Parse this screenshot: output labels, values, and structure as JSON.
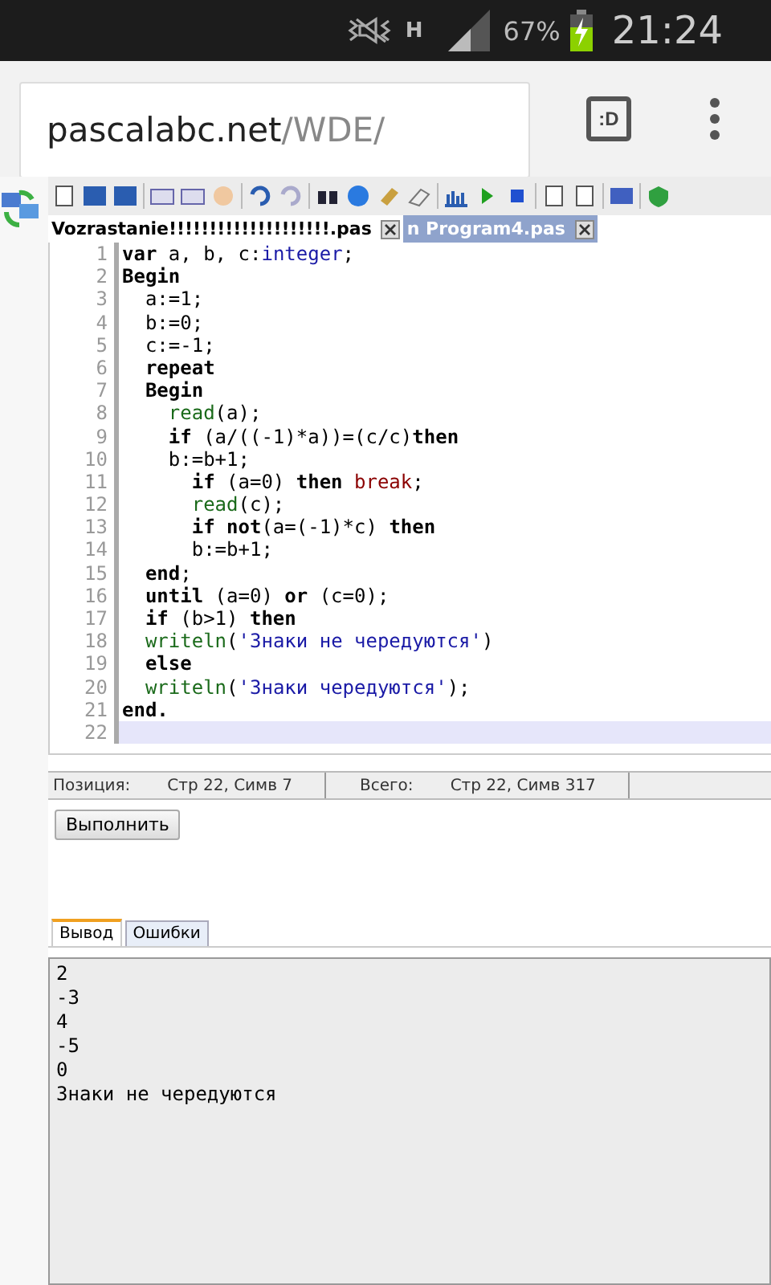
{
  "status_bar": {
    "network": "H",
    "battery": "67%",
    "time": "21:24"
  },
  "browser": {
    "url_host": "pascalabc.net",
    "url_path": "/WDE/",
    "tab_button": ":D"
  },
  "editor_tabs": [
    {
      "label": "Vozrastanie!!!!!!!!!!!!!!!!!!!!.pas",
      "selected": false
    },
    {
      "label": "n Program4.pas",
      "selected": true
    }
  ],
  "code": {
    "lines": [
      {
        "number": "1",
        "current": false,
        "tokens": [
          {
            "kind": "kw",
            "text": "var"
          },
          {
            "kind": "plain",
            "text": " a, b, c:"
          },
          {
            "kind": "type",
            "text": "integer"
          },
          {
            "kind": "plain",
            "text": ";"
          }
        ]
      },
      {
        "number": "2",
        "current": false,
        "tokens": [
          {
            "kind": "kw",
            "text": "Begin"
          }
        ]
      },
      {
        "number": "3",
        "current": false,
        "tokens": [
          {
            "kind": "plain",
            "text": "  a:=1;"
          }
        ]
      },
      {
        "number": "4",
        "current": false,
        "tokens": [
          {
            "kind": "plain",
            "text": "  b:=0;"
          }
        ]
      },
      {
        "number": "5",
        "current": false,
        "tokens": [
          {
            "kind": "plain",
            "text": "  c:=-1;"
          }
        ]
      },
      {
        "number": "6",
        "current": false,
        "tokens": [
          {
            "kind": "kw",
            "text": "  repeat"
          }
        ]
      },
      {
        "number": "7",
        "current": false,
        "tokens": [
          {
            "kind": "kw",
            "text": "  Begin"
          }
        ]
      },
      {
        "number": "8",
        "current": false,
        "tokens": [
          {
            "kind": "func",
            "text": "    read"
          },
          {
            "kind": "plain",
            "text": "(a);"
          }
        ]
      },
      {
        "number": "9",
        "current": false,
        "tokens": [
          {
            "kind": "kw",
            "text": "    if"
          },
          {
            "kind": "plain",
            "text": " (a/((-1)*a))=(c/c)"
          },
          {
            "kind": "kw",
            "text": "then"
          }
        ]
      },
      {
        "number": "10",
        "current": false,
        "tokens": [
          {
            "kind": "plain",
            "text": "    b:=b+1;"
          }
        ]
      },
      {
        "number": "11",
        "current": false,
        "tokens": [
          {
            "kind": "kw",
            "text": "      if"
          },
          {
            "kind": "plain",
            "text": " (a=0) "
          },
          {
            "kind": "kw",
            "text": "then "
          },
          {
            "kind": "special",
            "text": "break"
          },
          {
            "kind": "plain",
            "text": ";"
          }
        ]
      },
      {
        "number": "12",
        "current": false,
        "tokens": [
          {
            "kind": "func",
            "text": "      read"
          },
          {
            "kind": "plain",
            "text": "(c);"
          }
        ]
      },
      {
        "number": "13",
        "current": false,
        "tokens": [
          {
            "kind": "kw",
            "text": "      if not"
          },
          {
            "kind": "plain",
            "text": "(a=(-1)*c) "
          },
          {
            "kind": "kw",
            "text": "then"
          }
        ]
      },
      {
        "number": "14",
        "current": false,
        "tokens": [
          {
            "kind": "plain",
            "text": "      b:=b+1;"
          }
        ]
      },
      {
        "number": "15",
        "current": false,
        "tokens": [
          {
            "kind": "kw",
            "text": "  end"
          },
          {
            "kind": "plain",
            "text": ";"
          }
        ]
      },
      {
        "number": "16",
        "current": false,
        "tokens": [
          {
            "kind": "kw",
            "text": "  until"
          },
          {
            "kind": "plain",
            "text": " (a=0) "
          },
          {
            "kind": "kw",
            "text": "or"
          },
          {
            "kind": "plain",
            "text": " (c=0);"
          }
        ]
      },
      {
        "number": "17",
        "current": false,
        "tokens": [
          {
            "kind": "kw",
            "text": "  if"
          },
          {
            "kind": "plain",
            "text": " (b>1) "
          },
          {
            "kind": "kw",
            "text": "then"
          }
        ]
      },
      {
        "number": "18",
        "current": false,
        "tokens": [
          {
            "kind": "func",
            "text": "  writeln"
          },
          {
            "kind": "plain",
            "text": "("
          },
          {
            "kind": "str",
            "text": "'Знаки не чередуются'"
          },
          {
            "kind": "plain",
            "text": ")"
          }
        ]
      },
      {
        "number": "19",
        "current": false,
        "tokens": [
          {
            "kind": "kw",
            "text": "  else"
          }
        ]
      },
      {
        "number": "20",
        "current": false,
        "tokens": [
          {
            "kind": "func",
            "text": "  writeln"
          },
          {
            "kind": "plain",
            "text": "("
          },
          {
            "kind": "str",
            "text": "'Знаки чередуются'"
          },
          {
            "kind": "plain",
            "text": ");"
          }
        ]
      },
      {
        "number": "21",
        "current": false,
        "tokens": [
          {
            "kind": "kw",
            "text": "end."
          }
        ]
      },
      {
        "number": "22",
        "current": true
      }
    ]
  },
  "position_bar": {
    "position_label": "Позиция:",
    "position_value": "Стр 22, Симв 7",
    "total_label": "Всего:",
    "total_value": "Стр 22, Симв 317"
  },
  "run_button": "Выполнить",
  "output_tabs": [
    {
      "label": "Вывод",
      "selected": true
    },
    {
      "label": "Ошибки",
      "selected": false
    }
  ],
  "output_lines": [
    "2",
    "-3",
    "4",
    "-5",
    "0",
    "Знаки не чередуются"
  ]
}
